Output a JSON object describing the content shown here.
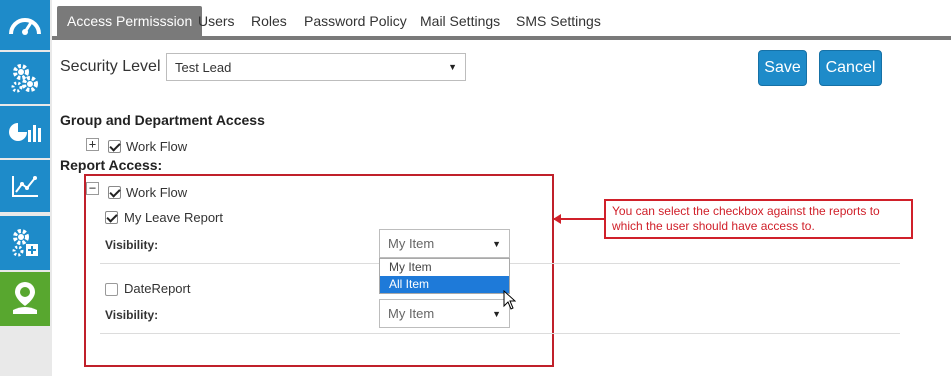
{
  "sidebar": {
    "items": [
      {
        "icon": "speedometer-icon",
        "color": "#1e8bc9"
      },
      {
        "icon": "gears-icon",
        "color": "#1e8bc9"
      },
      {
        "icon": "pie-bar-chart-icon",
        "color": "#1e8bc9"
      },
      {
        "icon": "trend-chart-icon",
        "color": "#1e8bc9"
      },
      {
        "icon": "gears-plus-icon",
        "color": "#1e8bc9"
      },
      {
        "icon": "user-badge-icon",
        "color": "#58a72f",
        "active": true
      }
    ]
  },
  "tabs": [
    {
      "label": "Access Permisssion",
      "active": true
    },
    {
      "label": "Users"
    },
    {
      "label": "Roles"
    },
    {
      "label": "Password Policy"
    },
    {
      "label": "Mail Settings"
    },
    {
      "label": "SMS Settings"
    }
  ],
  "security": {
    "label": "Security Level",
    "selected": "Test Lead"
  },
  "actions": {
    "save": "Save",
    "cancel": "Cancel"
  },
  "group_access": {
    "heading": "Group and Department Access",
    "workflow_label": "Work Flow",
    "toggle": "+"
  },
  "report_access": {
    "heading": "Report Access:",
    "toggle": "−",
    "workflow_label": "Work Flow",
    "reports": [
      {
        "label": "My Leave Report",
        "checked": true,
        "visibility_label": "Visibility:",
        "visibility_value": "My Item"
      },
      {
        "label": "DateReport",
        "checked": false,
        "visibility_label": "Visibility:",
        "visibility_value": "My Item"
      }
    ],
    "dropdown_options": [
      "My Item",
      "All Item"
    ],
    "dropdown_highlighted": "All Item"
  },
  "callout": {
    "text": "You can select the checkbox against the reports to which the user should have access to."
  },
  "colors": {
    "accent": "#1e8bc9",
    "active_sidebar": "#58a72f",
    "annotation": "#d0202a"
  }
}
